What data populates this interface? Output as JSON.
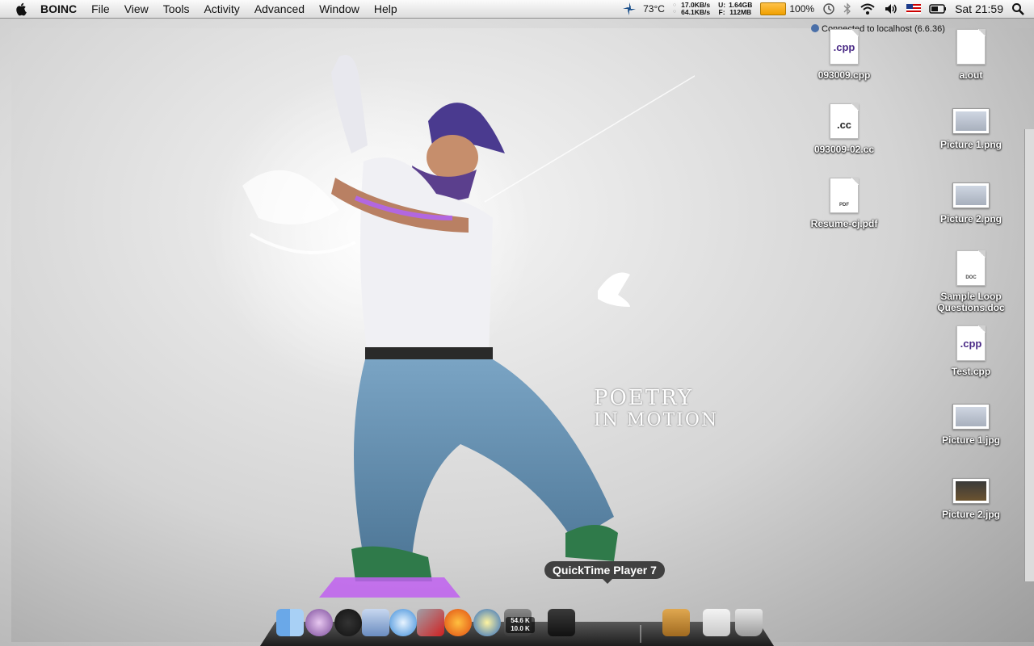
{
  "menubar": {
    "app_name": "BOINC",
    "items": [
      "File",
      "View",
      "Tools",
      "Activity",
      "Advanced",
      "Window",
      "Help"
    ],
    "status": {
      "temperature": "73°C",
      "net_up": "17.0KB/s",
      "net_down": "64.1KB/s",
      "mem_used_label": "U:",
      "mem_used": "1.64GB",
      "mem_free_label": "F:",
      "mem_free": "112MB",
      "battery": "100%",
      "clock": "Sat 21:59"
    }
  },
  "boinc": {
    "connection": "Connected to localhost (6.6.36)"
  },
  "wallpaper": {
    "text_line1": "POETRY",
    "text_line2": "IN MOTION"
  },
  "desktop_icons": [
    {
      "name": "093009.cpp",
      "ext": ".cpp"
    },
    {
      "name": "a.out",
      "ext": ""
    },
    {
      "name": "093009-02.cc",
      "ext": ".cc"
    },
    {
      "name": "Picture 1.png"
    },
    {
      "name": "Resume-cj.pdf",
      "ext": "PDF"
    },
    {
      "name": "Picture 2.png"
    },
    {
      "name": "Sample Loop Questions.doc",
      "ext": "DOC"
    },
    {
      "name": "Test.cpp",
      "ext": ".cpp"
    },
    {
      "name": "Picture 1.jpg"
    },
    {
      "name": "Picture 2.jpg"
    }
  ],
  "dock": {
    "tooltip": "QuickTime Player 7",
    "net_meter_top": "54.6 K",
    "net_meter_bottom": "10.0 K",
    "icons": [
      "finder-icon",
      "gyroscope-icon",
      "adium-icon",
      "mail-icon",
      "itunes-icon",
      "parallels-icon",
      "firefox-icon",
      "boinc-icon",
      "netmonitor-icon",
      "quicktime-icon",
      "address-book-icon",
      "home-folder-icon",
      "trash-icon"
    ]
  }
}
